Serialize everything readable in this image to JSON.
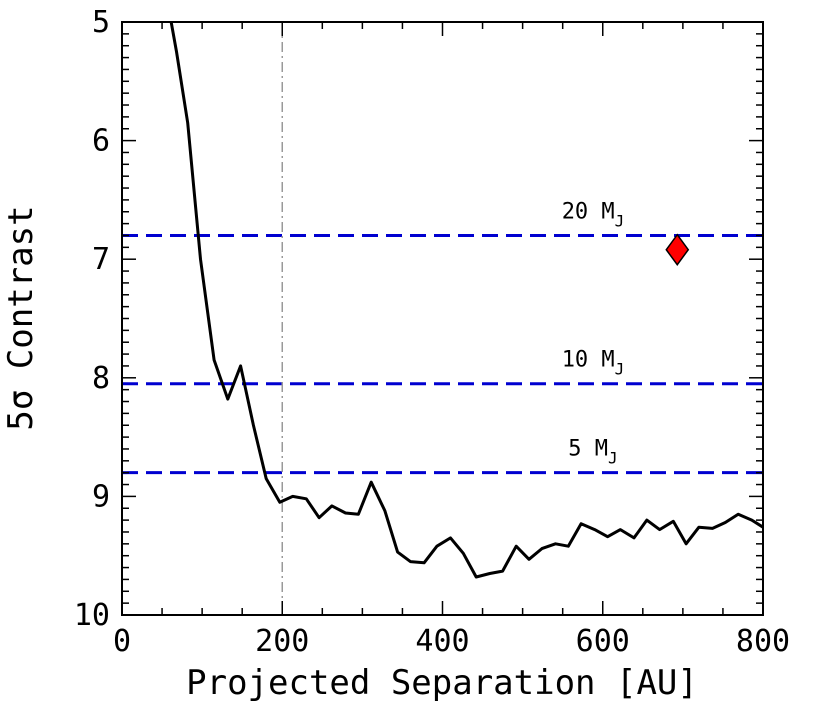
{
  "chart_data": {
    "type": "line",
    "title": "",
    "xlabel": "Projected Separation [AU]",
    "ylabel": "5σ Contrast",
    "xlim": [
      0,
      800
    ],
    "ylim": [
      5,
      10
    ],
    "y_inverted": true,
    "grid": false,
    "x_ticks": [
      "0",
      "200",
      "400",
      "600",
      "800"
    ],
    "y_ticks": [
      "5",
      "6",
      "7",
      "8",
      "9",
      "10"
    ],
    "series": [
      {
        "color": "#000000",
        "x": [
          60,
          68,
          82,
          98,
          115,
          132,
          148,
          164,
          180,
          197,
          213,
          230,
          246,
          262,
          279,
          295,
          311,
          328,
          344,
          360,
          377,
          393,
          410,
          426,
          442,
          459,
          475,
          492,
          508,
          524,
          541,
          557,
          573,
          590,
          606,
          622,
          639,
          655,
          671,
          688,
          704,
          720,
          737,
          753,
          769,
          786,
          800
        ],
        "y": [
          4.95,
          5.25,
          5.85,
          7.0,
          7.85,
          8.18,
          7.9,
          8.4,
          8.85,
          9.05,
          9.0,
          9.02,
          9.18,
          9.08,
          9.14,
          9.15,
          8.88,
          9.12,
          9.47,
          9.55,
          9.56,
          9.42,
          9.35,
          9.48,
          9.68,
          9.65,
          9.63,
          9.42,
          9.53,
          9.44,
          9.4,
          9.42,
          9.23,
          9.28,
          9.34,
          9.28,
          9.35,
          9.2,
          9.28,
          9.21,
          9.4,
          9.26,
          9.27,
          9.22,
          9.15,
          9.2,
          9.26
        ]
      }
    ],
    "reference_lines": [
      {
        "orientation": "horizontal",
        "y": 6.8,
        "color": "#0000d0",
        "style": "dashed",
        "label": "20 M",
        "sub": "J"
      },
      {
        "orientation": "horizontal",
        "y": 8.05,
        "color": "#0000d0",
        "style": "dashed",
        "label": "10 M",
        "sub": "J"
      },
      {
        "orientation": "horizontal",
        "y": 8.8,
        "color": "#0000d0",
        "style": "dashed",
        "label": "5 M",
        "sub": "J"
      },
      {
        "orientation": "vertical",
        "x": 200,
        "color": "#999999",
        "style": "dash-dot"
      }
    ],
    "markers": [
      {
        "x": 693,
        "y": 6.92,
        "shape": "diamond",
        "color": "#ff0000"
      }
    ]
  }
}
